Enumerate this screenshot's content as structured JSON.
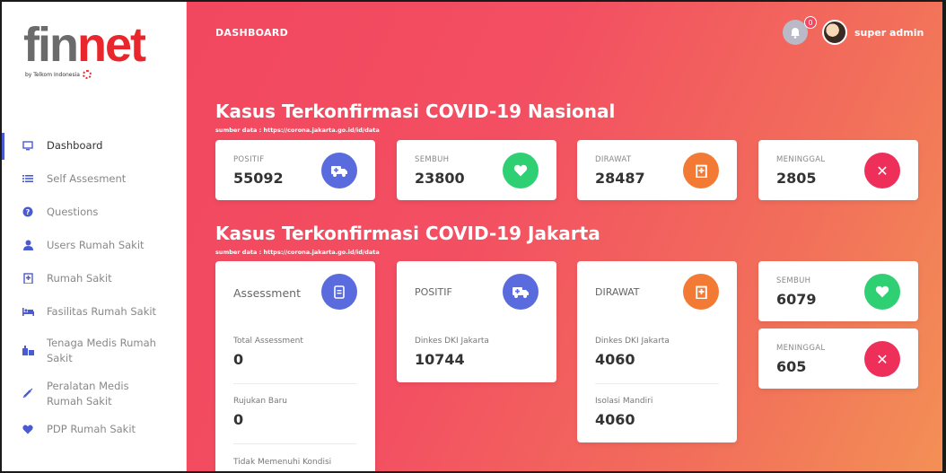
{
  "brand": {
    "fin": "fin",
    "net": "net",
    "tagline": "by Telkom Indonesia"
  },
  "sidebar": {
    "items": [
      {
        "label": "Dashboard",
        "icon": "monitor-icon"
      },
      {
        "label": "Self Assesment",
        "icon": "list-icon"
      },
      {
        "label": "Questions",
        "icon": "question-icon"
      },
      {
        "label": "Users Rumah Sakit",
        "icon": "user-icon"
      },
      {
        "label": "Rumah Sakit",
        "icon": "hospital-icon"
      },
      {
        "label": "Fasilitas Rumah Sakit",
        "icon": "bed-icon"
      },
      {
        "label": "Tenaga Medis Rumah Sakit",
        "icon": "staff-icon"
      },
      {
        "label": "Peralatan Medis Rumah Sakit",
        "icon": "syringe-icon"
      },
      {
        "label": "PDP Rumah Sakit",
        "icon": "heart-icon"
      }
    ]
  },
  "topbar": {
    "title": "DASHBOARD",
    "notifications": "0",
    "user": "super admin"
  },
  "nasional": {
    "title": "Kasus Terkonfirmasi COVID-19 Nasional",
    "source": "sumber data : https://corona.jakarta.go.id/id/data",
    "cards": [
      {
        "label": "POSITIF",
        "value": "55092",
        "icon": "ambulance-icon",
        "color": "#5a6bde"
      },
      {
        "label": "SEMBUH",
        "value": "23800",
        "icon": "heart-icon",
        "color": "#2fcf73"
      },
      {
        "label": "DIRAWAT",
        "value": "28487",
        "icon": "hospital-icon",
        "color": "#f37a35"
      },
      {
        "label": "MENINGGAL",
        "value": "2805",
        "icon": "close-icon",
        "color": "#ee2f5a"
      }
    ]
  },
  "jakarta": {
    "title": "Kasus Terkonfirmasi COVID-19 Jakarta",
    "source": "sumber data : https://corona.jakarta.go.id/id/data",
    "assessment": {
      "header": "Assessment",
      "rows": [
        {
          "label": "Total Assessment",
          "value": "0"
        },
        {
          "label": "Rujukan Baru",
          "value": "0"
        },
        {
          "label": "Tidak Memenuhi Kondisi",
          "value": ""
        }
      ]
    },
    "positif": {
      "header": "POSITIF",
      "label": "Dinkes DKI Jakarta",
      "value": "10744"
    },
    "dirawat": {
      "header": "DIRAWAT",
      "rows": [
        {
          "label": "Dinkes DKI Jakarta",
          "value": "4060"
        },
        {
          "label": "Isolasi Mandiri",
          "value": "4060"
        }
      ]
    },
    "sembuh": {
      "label": "SEMBUH",
      "value": "6079"
    },
    "meninggal": {
      "label": "MENINGGAL",
      "value": "605"
    }
  }
}
